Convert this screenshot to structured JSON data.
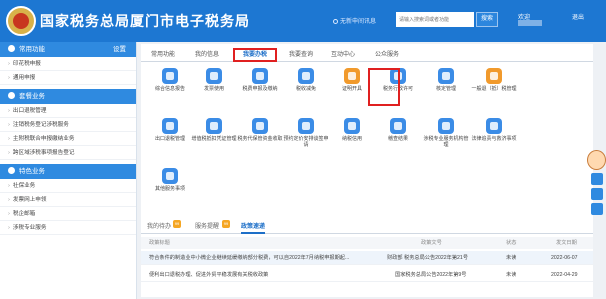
{
  "header": {
    "title": "国家税务总局厦门市电子税务局",
    "unread": "无新申间讯息",
    "search_placeholder": "请输入搜索词或者功能",
    "search_button": "搜索",
    "welcome": "欢迎",
    "logout": "退出",
    "colors": {
      "bg": "#1d77d2",
      "accent": "#e02020"
    }
  },
  "sidebar": {
    "section1": {
      "title": "常用功能",
      "action": "设置"
    },
    "section1_items": [
      "印花税申报",
      "通用申报"
    ],
    "section2": {
      "title": "套餐业务"
    },
    "section2_items": [
      "出口退税管理",
      "注销税务登记涉税服务",
      "主附税联合申报缴纳业务",
      "跨区域涉税事项报告登记"
    ],
    "section3": {
      "title": "特色业务"
    },
    "section3_items": [
      "社保业务",
      "发票网上申领",
      "税企邮箱",
      "涉税专业服务"
    ]
  },
  "main": {
    "tabs": [
      "常用功能",
      "我的信息",
      "我要办税",
      "我要查询",
      "互动中心",
      "公众服务"
    ],
    "active_tab": "我要办税",
    "grid": [
      {
        "label": "综合信息报告",
        "icon": "report-icon",
        "color": "#3b8ce6"
      },
      {
        "label": "发票使用",
        "icon": "invoice-icon",
        "color": "#3b8ce6"
      },
      {
        "label": "税费申报及缴纳",
        "icon": "tax-declare-icon",
        "color": "#3b8ce6"
      },
      {
        "label": "税收减免",
        "icon": "tax-reduction-icon",
        "color": "#3b8ce6"
      },
      {
        "label": "证明开具",
        "icon": "certificate-icon",
        "color": "#f19a2c"
      },
      {
        "label": "税务行政许可",
        "icon": "license-icon",
        "color": "#3b8ce6"
      },
      {
        "label": "核定管理",
        "icon": "approval-icon",
        "color": "#3b8ce6"
      },
      {
        "label": "一般退（抵）税管理",
        "icon": "refund-icon",
        "color": "#f19a2c"
      },
      {
        "label": "出口退税管理",
        "icon": "export-refund-icon",
        "color": "#3b8ce6"
      },
      {
        "label": "增值税抵扣凭证管理",
        "icon": "vat-voucher-icon",
        "color": "#3b8ce6"
      },
      {
        "label": "税务代保管资金收取",
        "icon": "custody-fund-icon",
        "color": "#3b8ce6"
      },
      {
        "label": "预约定价安排谈签申请",
        "icon": "pricing-icon",
        "color": "#3b8ce6"
      },
      {
        "label": "纳税信用",
        "icon": "credit-icon",
        "color": "#3b8ce6"
      },
      {
        "label": "稽查结果",
        "icon": "inspection-icon",
        "color": "#3b8ce6"
      },
      {
        "label": "涉税专业服务机构管理",
        "icon": "agency-icon",
        "color": "#3b8ce6"
      },
      {
        "label": "法律追责与救济事项",
        "icon": "law-icon",
        "color": "#3b8ce6"
      },
      {
        "label": "其他服务事项",
        "icon": "other-icon",
        "color": "#3b8ce6"
      }
    ]
  },
  "notice": {
    "tabs": [
      "我的待办",
      "服务提醒",
      "政策速递"
    ],
    "badges": [
      "99",
      "99"
    ],
    "active_tab": "政策速递",
    "columns": [
      "政策标题",
      "政策文号",
      "状态",
      "发文日期"
    ],
    "rows": [
      {
        "title": "符合条件的制造业中小微企业继续延缓缴纳部分税费，可以自2022年7月纳税申报期起...",
        "doc": "财政部 税务总局公告2022年第21号",
        "status": "未读",
        "date": "2022-06-07"
      },
      {
        "title": "便利出口退税办理、促进外贸平稳发展有关税收政策",
        "doc": "国家税务总局公告2022年第9号",
        "status": "未读",
        "date": "2022-04-29"
      }
    ]
  }
}
